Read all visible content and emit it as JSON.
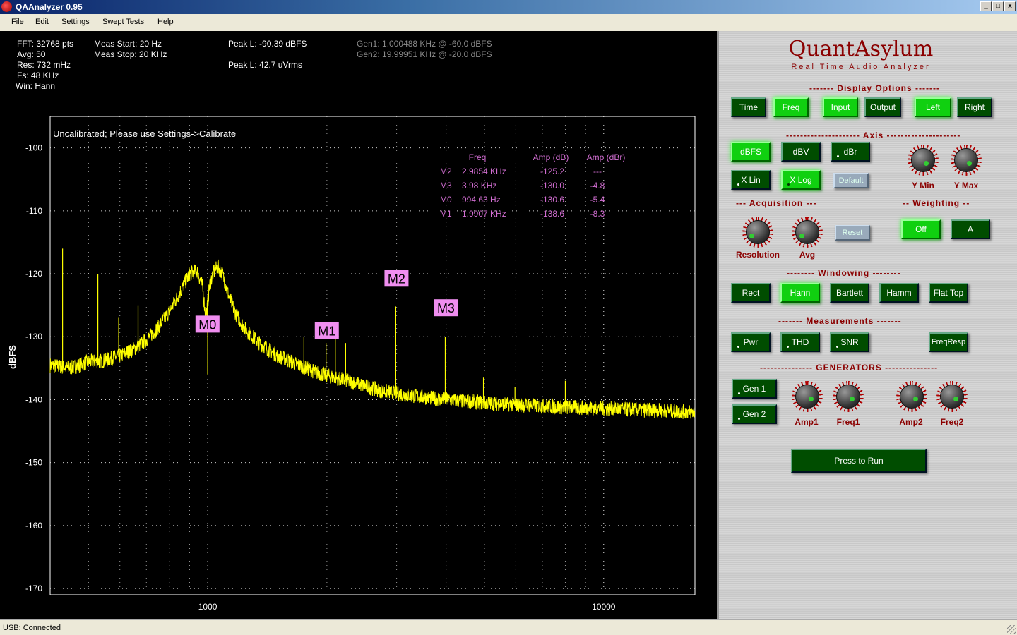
{
  "window": {
    "title": "QAAnalyzer 0.95"
  },
  "menu": [
    "File",
    "Edit",
    "Settings",
    "Swept Tests",
    "Help"
  ],
  "info": {
    "col1": [
      "FFT: 32768 pts",
      "Avg: 50",
      "Res: 732 mHz",
      "Fs: 48 KHz",
      "Win: Hann"
    ],
    "col2": [
      "Meas Start: 20 Hz",
      "Meas Stop: 20 KHz"
    ],
    "peak1": "Peak L: -90.39 dBFS",
    "peak2": "Peak L: 42.7 uVrms",
    "gen1": "Gen1: 1.000488 KHz @ -60.0 dBFS",
    "gen2": "Gen2: 19.99951 KHz @ -20.0 dBFS"
  },
  "status": "USB: Connected",
  "brand": {
    "name": "QuantAsylum",
    "tagline": "Real Time Audio Analyzer"
  },
  "panel": {
    "display_options": "------- Display Options -------",
    "display_buttons": [
      "Time",
      "Freq",
      "Input",
      "Output",
      "Left",
      "Right"
    ],
    "axis": "--------------------- Axis ---------------------",
    "axis_buttons": [
      "dBFS",
      "dBV",
      "dBr",
      "X Lin",
      "X Log",
      "Default"
    ],
    "ymin": "Y Min",
    "ymax": "Y Max",
    "acquisition": "--- Acquisition ---",
    "weighting": "-- Weighting --",
    "resolution": "Resolution",
    "avg": "Avg",
    "reset": "Reset",
    "weighting_buttons": [
      "Off",
      "A"
    ],
    "windowing": "-------- Windowing --------",
    "window_buttons": [
      "Rect",
      "Hann",
      "Bartlett",
      "Hamm",
      "Flat Top"
    ],
    "measurements": "------- Measurements -------",
    "meas_buttons": [
      "Pwr",
      "THD",
      "SNR",
      "FreqResp"
    ],
    "generators": "--------------- GENERATORS ---------------",
    "gen_buttons": [
      "Gen 1",
      "Gen 2"
    ],
    "gen_knobs": [
      "Amp1",
      "Freq1",
      "Amp2",
      "Freq2"
    ],
    "run": "Press to Run"
  },
  "chart_data": {
    "type": "line",
    "title": "Uncalibrated; Please use Settings->Calibrate",
    "ylabel": "dBFS",
    "xlabel": "",
    "xscale": "log",
    "xlim": [
      400,
      17000
    ],
    "ylim": [
      -171,
      -165,
      -95
    ],
    "yrange": [
      -171,
      -95
    ],
    "yticks": [
      -100,
      -110,
      -120,
      -130,
      -140,
      -150,
      -160,
      -170
    ],
    "xticks": [
      1000,
      10000
    ],
    "xtick_labels": [
      "1000",
      "10000"
    ],
    "grid": true,
    "trace_color": "#ffff00",
    "series": [
      {
        "x": [
          400,
          450,
          500,
          550,
          600,
          650,
          700,
          750,
          800,
          850,
          900,
          940,
          970,
          985,
          995,
          1010,
          1030,
          1060,
          1090,
          1130,
          1180,
          1250,
          1350,
          1500,
          1700,
          1900,
          2100,
          2400,
          2700,
          3000,
          3500,
          4000,
          5000,
          6000,
          7000,
          8000,
          10000,
          12000,
          15000,
          17000
        ],
        "y": [
          -134.5,
          -135,
          -134,
          -133.8,
          -133,
          -132,
          -130.5,
          -128.5,
          -126,
          -123,
          -120,
          -119.5,
          -122,
          -126,
          -126,
          -122,
          -120,
          -118.8,
          -120,
          -123.5,
          -126.5,
          -129,
          -131,
          -133,
          -134.5,
          -135.8,
          -136.5,
          -137.5,
          -138.5,
          -139,
          -139.6,
          -140,
          -140.5,
          -140.8,
          -141,
          -141.2,
          -141.4,
          -141.6,
          -141.8,
          -142
        ]
      }
    ],
    "spikes": [
      {
        "x": 430,
        "y": -116
      },
      {
        "x": 528,
        "y": -120
      },
      {
        "x": 596,
        "y": -127
      },
      {
        "x": 667,
        "y": -125
      },
      {
        "x": 1000,
        "y": -136
      },
      {
        "x": 1750,
        "y": -130
      },
      {
        "x": 1990,
        "y": -131
      },
      {
        "x": 2100,
        "y": -130
      },
      {
        "x": 2230,
        "y": -131
      },
      {
        "x": 2985,
        "y": -125.2
      },
      {
        "x": 3980,
        "y": -130
      },
      {
        "x": 4970,
        "y": -136.5
      },
      {
        "x": 5970,
        "y": -138
      },
      {
        "x": 8000,
        "y": -137
      }
    ],
    "markers": [
      {
        "label": "M0",
        "x": 994.63,
        "y": -128
      },
      {
        "label": "M1",
        "x": 1990.7,
        "y": -129
      },
      {
        "label": "M2",
        "x": 2985.4,
        "y": -120.7
      },
      {
        "label": "M3",
        "x": 3980,
        "y": -125.4
      }
    ],
    "marker_table": {
      "headers": [
        "Freq",
        "Amp (dB)",
        "Amp (dBr)"
      ],
      "rows": [
        {
          "name": "M2",
          "freq": "2.9854 KHz",
          "amp": "-125.2",
          "dbr": "---"
        },
        {
          "name": "M3",
          "freq": "3.98 KHz",
          "amp": "-130.0",
          "dbr": "-4.8"
        },
        {
          "name": "M0",
          "freq": "994.63 Hz",
          "amp": "-130.6",
          "dbr": "-5.4"
        },
        {
          "name": "M1",
          "freq": "1.9907 KHz",
          "amp": "-138.6",
          "dbr": "-8.3"
        }
      ]
    }
  }
}
